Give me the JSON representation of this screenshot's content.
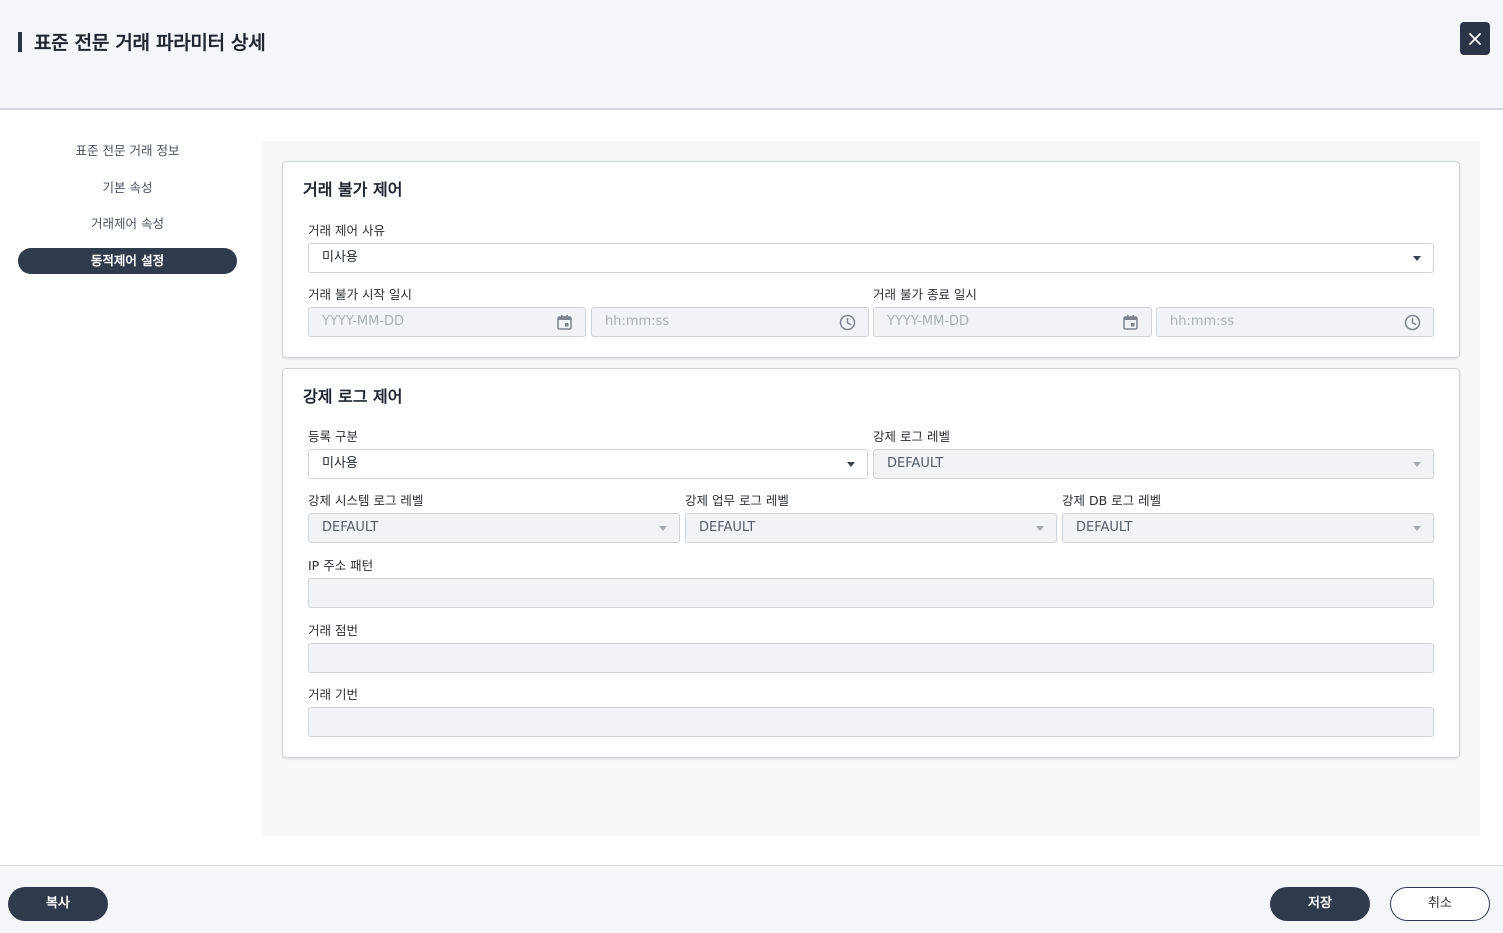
{
  "header": {
    "title": "표준 전문 거래 파라미터 상세"
  },
  "sidebar": {
    "items": [
      {
        "label": "표준 전문 거래 정보"
      },
      {
        "label": "기본 속성"
      },
      {
        "label": "거래제어 속성"
      },
      {
        "label": "동적제어 설정",
        "active": true
      }
    ]
  },
  "section_block": {
    "title": "거래 불가 제어",
    "reason_label": "거래 제어 사유",
    "reason_value": "미사용",
    "start_label": "거래 불가 시작 일시",
    "end_label": "거래 불가 종료 일시",
    "date_placeholder": "YYYY-MM-DD",
    "time_placeholder": "hh:mm:ss"
  },
  "section_log": {
    "title": "강제 로그 제어",
    "reg_label": "등록 구분",
    "reg_value": "미사용",
    "level_label": "강제 로그 레벨",
    "level_value": "DEFAULT",
    "sys_label": "강제 시스템 로그 레벨",
    "sys_value": "DEFAULT",
    "biz_label": "강제 업무 로그 레벨",
    "biz_value": "DEFAULT",
    "db_label": "강제 DB 로그 레벨",
    "db_value": "DEFAULT",
    "ip_label": "IP 주소 패턴",
    "ip_value": "",
    "branch_label": "거래 점번",
    "branch_value": "",
    "device_label": "거래 기번",
    "device_value": ""
  },
  "footer": {
    "copy_label": "복사",
    "save_label": "저장",
    "cancel_label": "취소"
  },
  "colors": {
    "primary_dark": "#2f3a4d",
    "border": "#cfd4db",
    "disabled_bg": "#f1f3f6"
  }
}
